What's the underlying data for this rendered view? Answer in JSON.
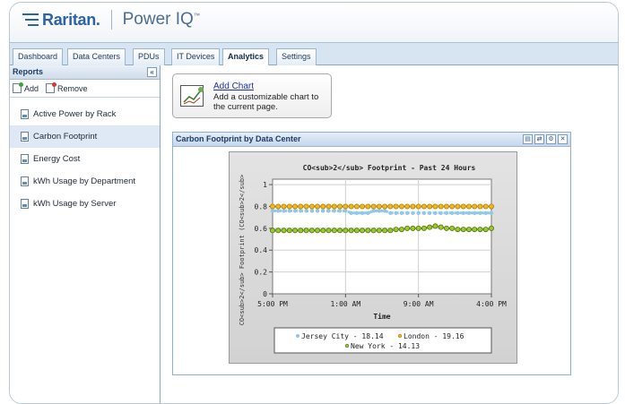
{
  "header": {
    "brand": "Raritan.",
    "product": "Power IQ",
    "product_mark": "™"
  },
  "tabs": [
    {
      "label": "Dashboard"
    },
    {
      "label": "Data Centers"
    },
    {
      "label": "PDUs"
    },
    {
      "label": "IT Devices"
    },
    {
      "label": "Analytics",
      "active": true
    },
    {
      "label": "Settings"
    }
  ],
  "sidebar": {
    "title": "Reports",
    "collapse": "«",
    "add_label": "Add",
    "remove_label": "Remove",
    "reports": [
      {
        "label": "Active Power by Rack"
      },
      {
        "label": "Carbon Footprint",
        "selected": true
      },
      {
        "label": "Energy Cost"
      },
      {
        "label": "kWh Usage by Department"
      },
      {
        "label": "kWh Usage by Server"
      }
    ]
  },
  "add_chart": {
    "title": "Add Chart",
    "description": "Add a customizable chart to the current page."
  },
  "portlet": {
    "title": "Carbon Footprint by Data Center",
    "buttons": [
      "▤",
      "⇄",
      "⚙",
      "✕"
    ]
  },
  "chart_data": {
    "type": "line",
    "title": "CO<sub>2</sub> Footprint - Past 24 Hours",
    "xlabel": "Time",
    "ylabel": "CO<sub>2</sub> Footprint (CO<sub>2</sub>",
    "x_ticks": [
      "5:00 PM",
      "1:00 AM",
      "9:00 AM",
      "4:00 PM"
    ],
    "y_ticks": [
      "0",
      "0.2",
      "0.4",
      "0.6",
      "0.8",
      "1"
    ],
    "ylim": [
      0,
      1.05
    ],
    "grid": true,
    "legend": "bottom",
    "colors": {
      "jersey": "#8fc8ea",
      "london": "#f0b623",
      "newyork": "#9bcb2a",
      "newyork_stroke": "#4f6e12"
    },
    "series": [
      {
        "name": "Jersey City - 18.14",
        "key": "jersey",
        "values": [
          0.76,
          0.76,
          0.76,
          0.76,
          0.76,
          0.76,
          0.76,
          0.76,
          0.76,
          0.76,
          0.76,
          0.76,
          0.76,
          0.76,
          0.74,
          0.74,
          0.74,
          0.74,
          0.76,
          0.76,
          0.76,
          0.74,
          0.74,
          0.74,
          0.74,
          0.74,
          0.74,
          0.74,
          0.74,
          0.74,
          0.74,
          0.74,
          0.74,
          0.74,
          0.74,
          0.74,
          0.74,
          0.74,
          0.74,
          0.74
        ]
      },
      {
        "name": "London - 19.16",
        "key": "london",
        "values": [
          0.8,
          0.8,
          0.8,
          0.8,
          0.8,
          0.8,
          0.8,
          0.8,
          0.8,
          0.8,
          0.8,
          0.8,
          0.8,
          0.8,
          0.8,
          0.8,
          0.8,
          0.8,
          0.8,
          0.8,
          0.8,
          0.8,
          0.8,
          0.8,
          0.8,
          0.8,
          0.8,
          0.8,
          0.8,
          0.8,
          0.8,
          0.8,
          0.8,
          0.8,
          0.8,
          0.8,
          0.8,
          0.8,
          0.8,
          0.8
        ]
      },
      {
        "name": "New York - 14.13",
        "key": "newyork",
        "values": [
          0.58,
          0.58,
          0.58,
          0.58,
          0.58,
          0.58,
          0.58,
          0.58,
          0.58,
          0.58,
          0.58,
          0.58,
          0.58,
          0.58,
          0.58,
          0.58,
          0.58,
          0.58,
          0.58,
          0.58,
          0.58,
          0.58,
          0.59,
          0.59,
          0.6,
          0.6,
          0.6,
          0.6,
          0.61,
          0.62,
          0.61,
          0.6,
          0.6,
          0.59,
          0.59,
          0.59,
          0.59,
          0.59,
          0.59,
          0.6
        ]
      }
    ]
  }
}
